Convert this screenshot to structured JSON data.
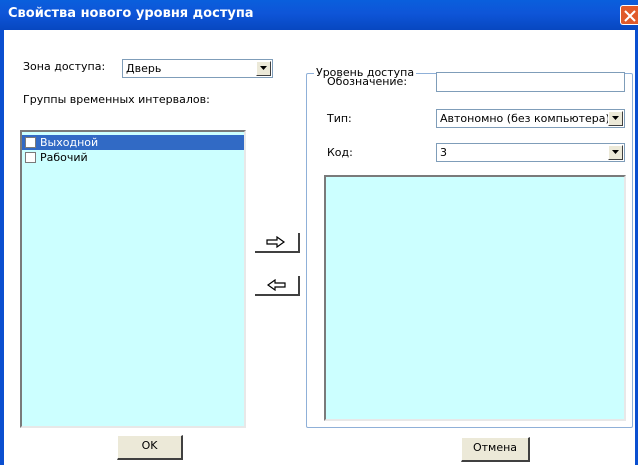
{
  "window": {
    "title": "Свойства нового уровня доступа",
    "close_icon": "close-icon"
  },
  "left": {
    "zone_label": "Зона доступа:",
    "zone_value": "Дверь",
    "groups_label": "Группы временных интервалов:",
    "groups": [
      {
        "label": "Выходной",
        "checked": false,
        "selected": true
      },
      {
        "label": "Рабочий",
        "checked": false,
        "selected": false
      }
    ]
  },
  "right": {
    "group_title": "Уровень доступа",
    "designation_label": "Обозначение:",
    "designation_value": "",
    "type_label": "Тип:",
    "type_value": "Автономно (без компьютера)",
    "code_label": "Код:",
    "code_value": "3",
    "list_items": []
  },
  "transfer": {
    "add_icon": "arrow-right-icon",
    "remove_icon": "arrow-left-icon"
  },
  "buttons": {
    "ok": "OK",
    "cancel": "Отмена"
  },
  "colors": {
    "titlebar": "#0a5fdc",
    "list_background": "#ccffff",
    "selection": "#316ac5"
  }
}
